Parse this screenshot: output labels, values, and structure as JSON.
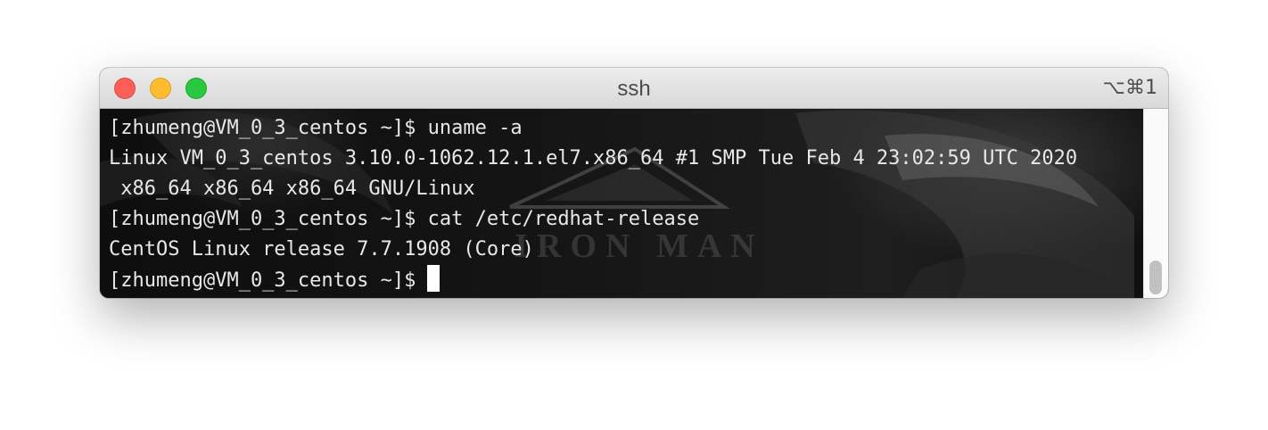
{
  "window": {
    "title": "ssh",
    "shortcut": "⌥⌘1"
  },
  "terminal": {
    "lines": [
      "[zhumeng@VM_0_3_centos ~]$ uname -a",
      "Linux VM_0_3_centos 3.10.0-1062.12.1.el7.x86_64 #1 SMP Tue Feb 4 23:02:59 UTC 2020",
      " x86_64 x86_64 x86_64 GNU/Linux",
      "[zhumeng@VM_0_3_centos ~]$ cat /etc/redhat-release",
      "CentOS Linux release 7.7.1908 (Core)"
    ],
    "prompt": "[zhumeng@VM_0_3_centos ~]$",
    "wallpaper_text": "IRON MAN"
  },
  "colors": {
    "close": "#fc5f57",
    "minimize": "#fdbb2e",
    "maximize": "#28c840",
    "terminal_text": "#e8e8e8",
    "terminal_background": "#0d0d0d"
  }
}
